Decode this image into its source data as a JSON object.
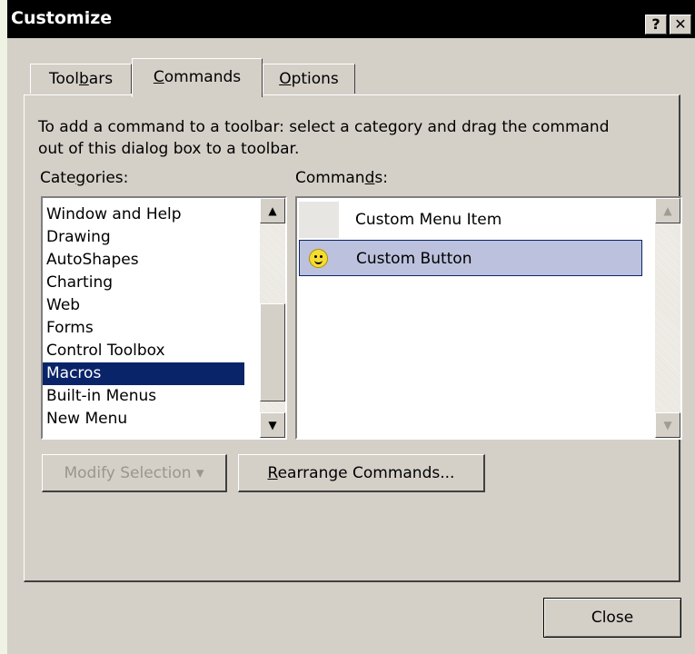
{
  "window": {
    "title": "Customize",
    "help_button": "?",
    "close_button": "✕"
  },
  "tabs": [
    {
      "pre": "Tool",
      "key": "b",
      "post": "ars"
    },
    {
      "pre": "",
      "key": "C",
      "post": "ommands"
    },
    {
      "pre": "",
      "key": "O",
      "post": "ptions"
    }
  ],
  "instructions": "To add a command to a toolbar: select a category and drag the command out of this dialog box to a toolbar.",
  "categories_label": {
    "pre": "Cate",
    "key": "g",
    "post": "ories:"
  },
  "commands_label": {
    "pre": "Comman",
    "key": "d",
    "post": "s:"
  },
  "categories": [
    "Window and Help",
    "Drawing",
    "AutoShapes",
    "Charting",
    "Web",
    "Forms",
    "Control Toolbox",
    "Macros",
    "Built-in Menus",
    "New Menu"
  ],
  "selected_category": "Macros",
  "commands": [
    {
      "label": "Custom Menu Item",
      "icon": "none"
    },
    {
      "label": "Custom Button",
      "icon": "smiley-icon"
    }
  ],
  "buttons": {
    "modify_selection": "Modify Selection ▾",
    "rearrange": {
      "pre": "",
      "key": "R",
      "post": "earrange Commands..."
    },
    "close": "Close"
  },
  "scroll_arrows": {
    "up": "▲",
    "down": "▼"
  }
}
